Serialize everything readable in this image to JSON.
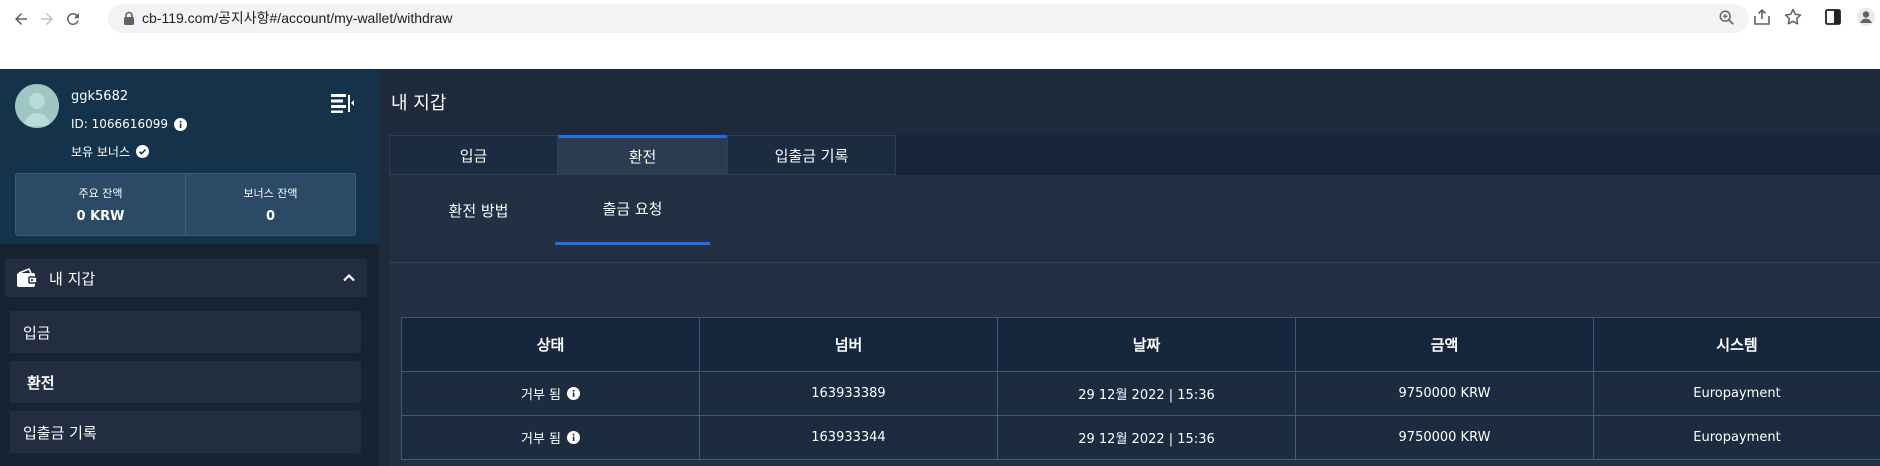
{
  "browser": {
    "url": "cb-119.com/공지사항#/account/my-wallet/withdraw",
    "icons": [
      "back-icon",
      "forward-icon",
      "reload-icon",
      "lock-icon",
      "zoom-icon",
      "share-icon",
      "star-icon",
      "sidepanel-icon",
      "profile-icon"
    ]
  },
  "profile": {
    "username": "ggk5682",
    "id_text": "ID: 1066616099",
    "bonus_label": "보유 보너스",
    "balances": [
      {
        "label": "주요 잔액",
        "value": "0 KRW"
      },
      {
        "label": "보너스 잔액",
        "value": "0"
      }
    ]
  },
  "sidebar": {
    "section_title": "내 지갑",
    "items": [
      {
        "label": "입금"
      },
      {
        "label": "환전"
      },
      {
        "label": "입출금 기록"
      }
    ]
  },
  "main": {
    "title": "내 지갑",
    "tabs": [
      {
        "label": "입금"
      },
      {
        "label": "환전"
      },
      {
        "label": "입출금 기록"
      }
    ],
    "subtabs": [
      {
        "label": "환전 방법"
      },
      {
        "label": "출금 요청"
      }
    ]
  },
  "table": {
    "headers": [
      "상태",
      "넘버",
      "날짜",
      "금액",
      "시스템"
    ],
    "rows": [
      {
        "status": "거부 됨",
        "number": "163933389",
        "date": "29 12월 2022 | 15:36",
        "amount": "9750000 KRW",
        "system": "Europayment"
      },
      {
        "status": "거부 됨",
        "number": "163933344",
        "date": "29 12월 2022 | 15:36",
        "amount": "9750000 KRW",
        "system": "Europayment"
      }
    ]
  },
  "colors": {
    "accent": "#1f6fe5",
    "sidebar_bg": "#172233",
    "profile_bg": "#14324a",
    "main_bg": "#232f42"
  }
}
